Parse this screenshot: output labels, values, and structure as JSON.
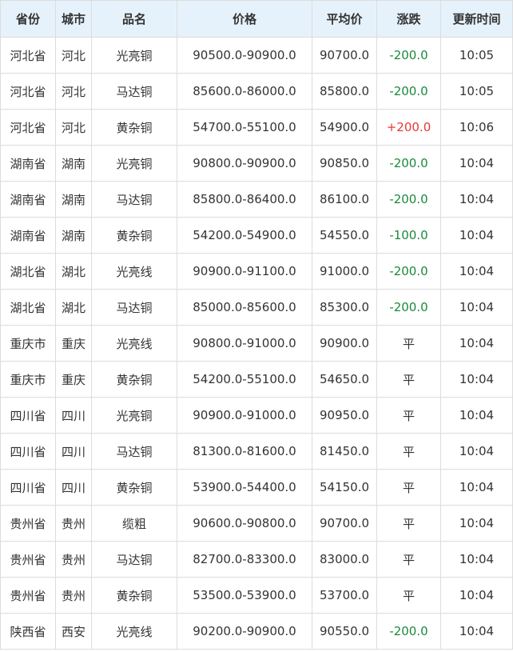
{
  "table": {
    "headers": [
      "省份",
      "城市",
      "品名",
      "价格",
      "平均价",
      "涨跌",
      "更新时间"
    ],
    "rows": [
      {
        "province": "河北省",
        "city": "河北",
        "product": "光亮铜",
        "price": "90500.0-90900.0",
        "avg": "90700.0",
        "change": "-200.0",
        "trend": "down",
        "time": "10:05"
      },
      {
        "province": "河北省",
        "city": "河北",
        "product": "马达铜",
        "price": "85600.0-86000.0",
        "avg": "85800.0",
        "change": "-200.0",
        "trend": "down",
        "time": "10:05"
      },
      {
        "province": "河北省",
        "city": "河北",
        "product": "黄杂铜",
        "price": "54700.0-55100.0",
        "avg": "54900.0",
        "change": "+200.0",
        "trend": "up",
        "time": "10:06"
      },
      {
        "province": "湖南省",
        "city": "湖南",
        "product": "光亮铜",
        "price": "90800.0-90900.0",
        "avg": "90850.0",
        "change": "-200.0",
        "trend": "down",
        "time": "10:04"
      },
      {
        "province": "湖南省",
        "city": "湖南",
        "product": "马达铜",
        "price": "85800.0-86400.0",
        "avg": "86100.0",
        "change": "-200.0",
        "trend": "down",
        "time": "10:04"
      },
      {
        "province": "湖南省",
        "city": "湖南",
        "product": "黄杂铜",
        "price": "54200.0-54900.0",
        "avg": "54550.0",
        "change": "-100.0",
        "trend": "down",
        "time": "10:04"
      },
      {
        "province": "湖北省",
        "city": "湖北",
        "product": "光亮线",
        "price": "90900.0-91100.0",
        "avg": "91000.0",
        "change": "-200.0",
        "trend": "down",
        "time": "10:04"
      },
      {
        "province": "湖北省",
        "city": "湖北",
        "product": "马达铜",
        "price": "85000.0-85600.0",
        "avg": "85300.0",
        "change": "-200.0",
        "trend": "down",
        "time": "10:04"
      },
      {
        "province": "重庆市",
        "city": "重庆",
        "product": "光亮线",
        "price": "90800.0-91000.0",
        "avg": "90900.0",
        "change": "平",
        "trend": "flat",
        "time": "10:04"
      },
      {
        "province": "重庆市",
        "city": "重庆",
        "product": "黄杂铜",
        "price": "54200.0-55100.0",
        "avg": "54650.0",
        "change": "平",
        "trend": "flat",
        "time": "10:04"
      },
      {
        "province": "四川省",
        "city": "四川",
        "product": "光亮铜",
        "price": "90900.0-91000.0",
        "avg": "90950.0",
        "change": "平",
        "trend": "flat",
        "time": "10:04"
      },
      {
        "province": "四川省",
        "city": "四川",
        "product": "马达铜",
        "price": "81300.0-81600.0",
        "avg": "81450.0",
        "change": "平",
        "trend": "flat",
        "time": "10:04"
      },
      {
        "province": "四川省",
        "city": "四川",
        "product": "黄杂铜",
        "price": "53900.0-54400.0",
        "avg": "54150.0",
        "change": "平",
        "trend": "flat",
        "time": "10:04"
      },
      {
        "province": "贵州省",
        "city": "贵州",
        "product": "缆粗",
        "price": "90600.0-90800.0",
        "avg": "90700.0",
        "change": "平",
        "trend": "flat",
        "time": "10:04"
      },
      {
        "province": "贵州省",
        "city": "贵州",
        "product": "马达铜",
        "price": "82700.0-83300.0",
        "avg": "83000.0",
        "change": "平",
        "trend": "flat",
        "time": "10:04"
      },
      {
        "province": "贵州省",
        "city": "贵州",
        "product": "黄杂铜",
        "price": "53500.0-53900.0",
        "avg": "53700.0",
        "change": "平",
        "trend": "flat",
        "time": "10:04"
      },
      {
        "province": "陕西省",
        "city": "西安",
        "product": "光亮线",
        "price": "90200.0-90900.0",
        "avg": "90550.0",
        "change": "-200.0",
        "trend": "down",
        "time": "10:04"
      }
    ]
  },
  "colors": {
    "header_bg": "#e6f2fb",
    "border": "#dcdcdc",
    "up": "#e53935",
    "down": "#1a8a3a",
    "text": "#333333"
  }
}
